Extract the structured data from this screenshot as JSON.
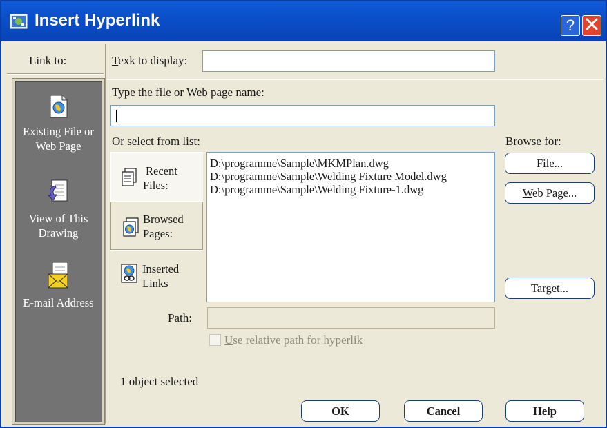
{
  "window": {
    "title": "Insert Hyperlink",
    "help_glyph": "?",
    "close_icon": "close-icon"
  },
  "link_to": {
    "label": "Link to:",
    "items": [
      {
        "label_line1": "Existing File or",
        "label_line2": "Web Page",
        "icon": "document-globe-icon"
      },
      {
        "label_line1": "View of This",
        "label_line2": "Drawing",
        "icon": "view-drawing-icon"
      },
      {
        "label_line1": "E-mail Address",
        "label_line2": "",
        "icon": "email-envelope-icon"
      }
    ]
  },
  "text_to_display": {
    "label_underlined": "T",
    "label_rest": "exk to display:",
    "value": ""
  },
  "file_name": {
    "label_before": "Type the fil",
    "label_underlined": "e",
    "label_after": " or Web page name:",
    "value": ""
  },
  "list": {
    "label": "Or select from list:",
    "tabs": [
      {
        "line1": "Recent",
        "line2": "Files:",
        "icon": "recent-files-icon"
      },
      {
        "line1": "Browsed",
        "line2": "Pages:",
        "icon": "browsed-pages-icon"
      },
      {
        "line1": "Inserted",
        "line2": "Links",
        "icon": "inserted-links-icon"
      }
    ],
    "items": [
      "D:\\programme\\Sample\\MKMPlan.dwg",
      "D:\\programme\\Sample\\Welding Fixture Model.dwg",
      "D:\\programme\\Sample\\Welding Fixture-1.dwg"
    ]
  },
  "browse": {
    "label": "Browse for:",
    "file_underlined": "F",
    "file_rest": "ile...",
    "web_underlined": "W",
    "web_rest": "eb Page...",
    "target": "Target..."
  },
  "path": {
    "label": "Path:",
    "value": ""
  },
  "relative": {
    "label_underlined": "U",
    "label_rest": "se relative path for hyperlik",
    "checked": false
  },
  "status": "1 object selected",
  "buttons": {
    "ok": "OK",
    "cancel": "Cancel",
    "help_before": "H",
    "help_underlined": "e",
    "help_after": "lp"
  },
  "colors": {
    "titlebar": "#0a4ec8",
    "close": "#e0442c",
    "panel": "#737373",
    "dialog": "#ece9d8"
  }
}
